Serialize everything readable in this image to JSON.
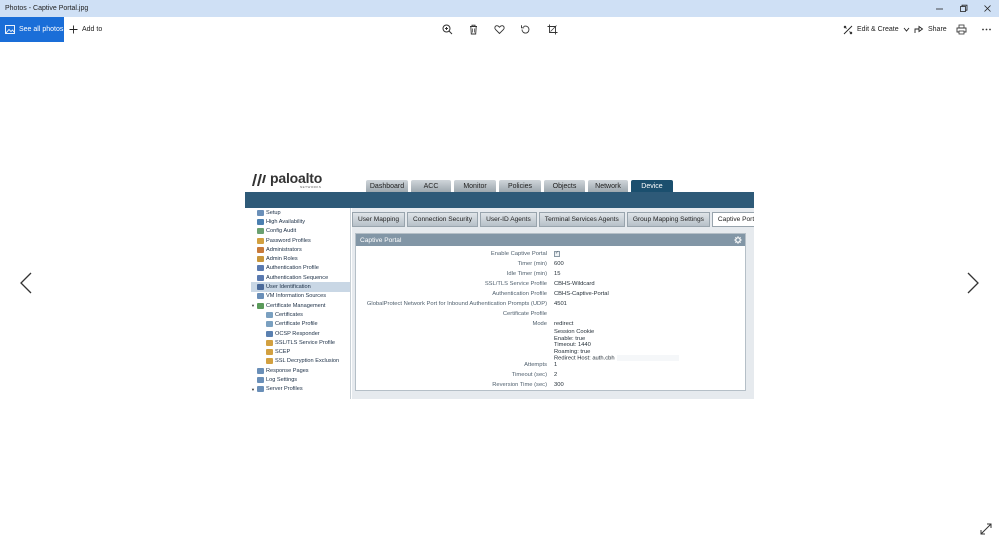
{
  "window": {
    "title": "Photos - Captive Portal.jpg",
    "controls": [
      "minimize",
      "maximize",
      "close"
    ]
  },
  "toolbar": {
    "see_all": "See all photos",
    "add_to": "Add to",
    "icons": [
      "zoom-in-icon",
      "delete-icon",
      "favorite-icon",
      "rotate-icon",
      "crop-icon"
    ],
    "edit_create": "Edit & Create",
    "share": "Share",
    "print_icon": "print-icon",
    "more_icon": "more-icon"
  },
  "photo": {
    "logo": "paloalto",
    "logo_sub": "NETWORKS",
    "nav_tabs": [
      {
        "label": "Dashboard",
        "active": false
      },
      {
        "label": "ACC",
        "active": false
      },
      {
        "label": "Monitor",
        "active": false
      },
      {
        "label": "Policies",
        "active": false
      },
      {
        "label": "Objects",
        "active": false
      },
      {
        "label": "Network",
        "active": false
      },
      {
        "label": "Device",
        "active": true
      }
    ],
    "sidebar": [
      {
        "label": "Setup",
        "level": 0,
        "color": "#6a8fb8"
      },
      {
        "label": "High Availability",
        "level": 0,
        "color": "#4b7fb0"
      },
      {
        "label": "Config Audit",
        "level": 0,
        "color": "#6aa070"
      },
      {
        "label": "Password Profiles",
        "level": 0,
        "color": "#d2a040"
      },
      {
        "label": "Administrators",
        "level": 0,
        "color": "#c87a3a"
      },
      {
        "label": "Admin Roles",
        "level": 0,
        "color": "#c8963a"
      },
      {
        "label": "Authentication Profile",
        "level": 0,
        "color": "#5a7ab0"
      },
      {
        "label": "Authentication Sequence",
        "level": 0,
        "color": "#5a7ab0"
      },
      {
        "label": "User Identification",
        "level": 0,
        "color": "#4a6a9a",
        "selected": true
      },
      {
        "label": "VM Information Sources",
        "level": 0,
        "color": "#6a8fb8"
      },
      {
        "label": "Certificate Management",
        "level": 0,
        "color": "#5a9a5a",
        "caret": true
      },
      {
        "label": "Certificates",
        "level": 1,
        "color": "#7aa0c0"
      },
      {
        "label": "Certificate Profile",
        "level": 1,
        "color": "#7aa0c0"
      },
      {
        "label": "OCSP Responder",
        "level": 1,
        "color": "#5a80b0"
      },
      {
        "label": "SSL/TLS Service Profile",
        "level": 1,
        "color": "#d2a040"
      },
      {
        "label": "SCEP",
        "level": 1,
        "color": "#d2a040"
      },
      {
        "label": "SSL Decryption Exclusion",
        "level": 1,
        "color": "#d2a040"
      },
      {
        "label": "Response Pages",
        "level": 0,
        "color": "#6a8fb8"
      },
      {
        "label": "Log Settings",
        "level": 0,
        "color": "#6a8fb8"
      },
      {
        "label": "Server Profiles",
        "level": 0,
        "color": "#6a8fb8",
        "caret": true
      }
    ],
    "subtabs": [
      {
        "label": "User Mapping",
        "active": false
      },
      {
        "label": "Connection Security",
        "active": false
      },
      {
        "label": "User-ID Agents",
        "active": false
      },
      {
        "label": "Terminal Services Agents",
        "active": false
      },
      {
        "label": "Group Mapping Settings",
        "active": false
      },
      {
        "label": "Captive Portal Settings",
        "active": true
      }
    ],
    "panel_title": "Captive Portal",
    "fields": {
      "enable_label": "Enable Captive Portal",
      "timer_label": "Timer (min)",
      "timer_value": "600",
      "idle_label": "Idle Timer (min)",
      "idle_value": "15",
      "ssl_label": "SSL/TLS Service Profile",
      "ssl_value": "CBHS-Wildcard",
      "auth_label": "Authentication Profile",
      "auth_value": "CBHS-Captive-Portal",
      "gp_label": "GlobalProtect Network Port for Inbound Authentication Prompts (UDP)",
      "gp_value": "4501",
      "cert_label": "Certificate Profile",
      "cert_value": "",
      "mode_label": "Mode",
      "mode_value": "redirect",
      "session_cookie": "Session Cookie",
      "enable_line": "Enable: true",
      "timeout_line": "Timeout: 1440",
      "roaming_line": "Roaming: true",
      "redirect_line": "Redirect Host: auth.cbh",
      "attempts_label": "Attempts",
      "attempts_value": "1",
      "timeout_label": "Timeout (sec)",
      "timeout_value": "2",
      "reversion_label": "Reversion Time (sec)",
      "reversion_value": "300"
    }
  }
}
